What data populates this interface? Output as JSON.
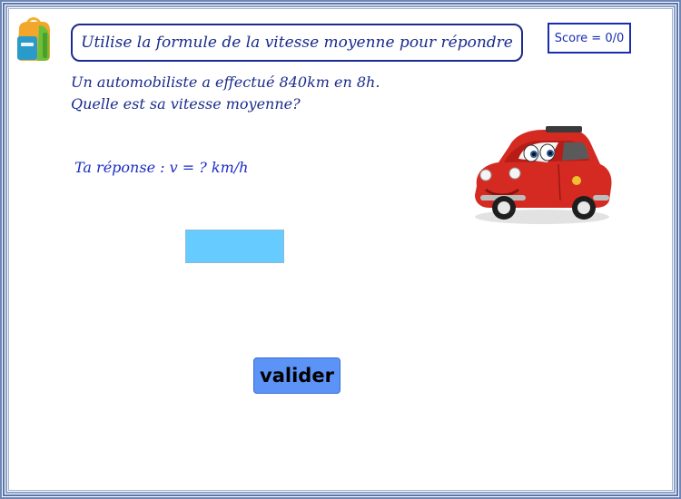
{
  "header": {
    "title": "Utilise la formule de la vitesse moyenne pour répondre",
    "score": "Score = 0/0"
  },
  "question": {
    "line1": "Un automobiliste a effectué 840km en 8h.",
    "line2": "Quelle est sa vitesse moyenne?"
  },
  "answer": {
    "label": "Ta réponse : v =  ? km/h",
    "value": ""
  },
  "actions": {
    "submit_label": "valider"
  },
  "images": {
    "backpack": "backpack-icon",
    "car": "red-cartoon-car"
  },
  "colors": {
    "text_primary": "#1a2c8c",
    "input_bg": "#66ccff",
    "button_bg": "#5c93f7",
    "border": "#5a74a6"
  }
}
